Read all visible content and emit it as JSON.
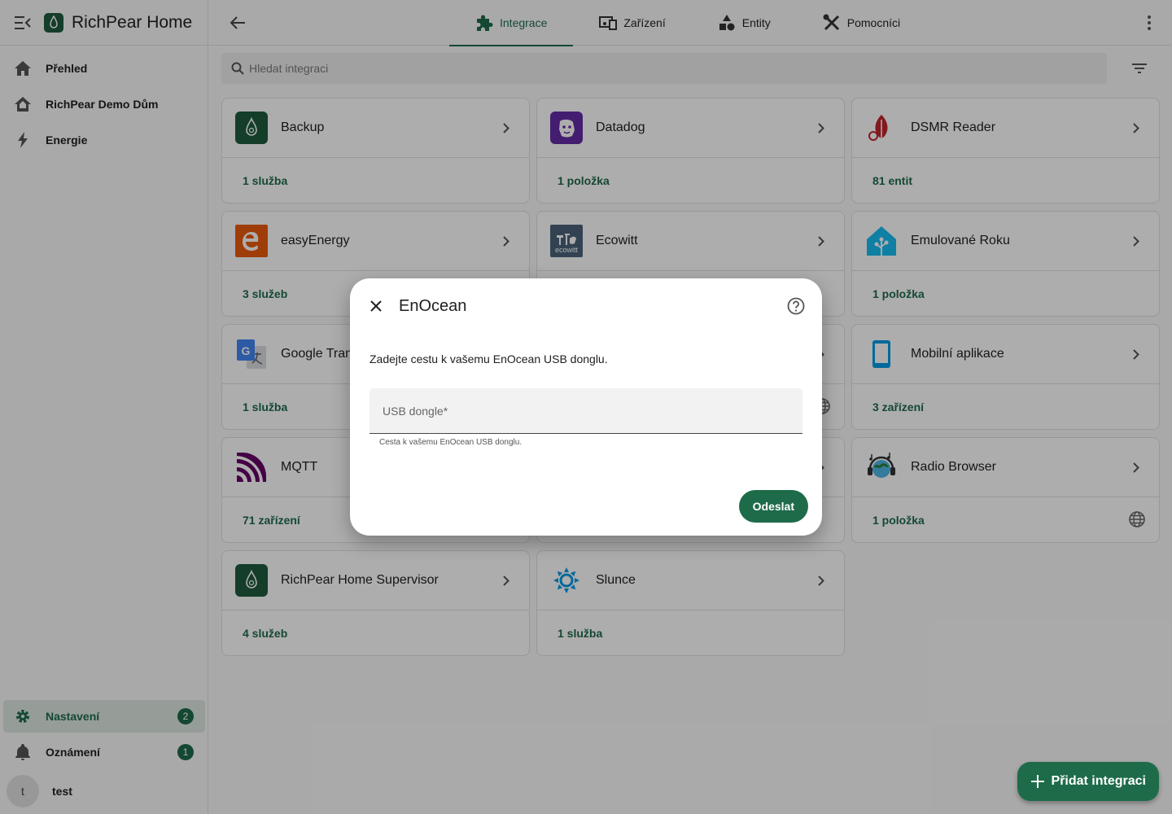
{
  "app": {
    "title": "RichPear Home"
  },
  "sidebar": {
    "items": [
      {
        "label": "Přehled",
        "icon": "home-icon"
      },
      {
        "label": "RichPear Demo Dům",
        "icon": "house-roof-icon"
      },
      {
        "label": "Energie",
        "icon": "lightning-icon"
      }
    ],
    "settings": {
      "label": "Nastavení",
      "badge": "2"
    },
    "notifications": {
      "label": "Oznámení",
      "badge": "1"
    },
    "user": {
      "initial": "t",
      "name": "test"
    }
  },
  "tabs": [
    {
      "label": "Integrace",
      "active": true
    },
    {
      "label": "Zařízení",
      "active": false
    },
    {
      "label": "Entity",
      "active": false
    },
    {
      "label": "Pomocníci",
      "active": false
    }
  ],
  "search": {
    "placeholder": "Hledat integraci"
  },
  "integrations": [
    {
      "name": "Backup",
      "link": "1 služba"
    },
    {
      "name": "Datadog",
      "link": "1 položka"
    },
    {
      "name": "DSMR Reader",
      "link": "81 entit"
    },
    {
      "name": "easyEnergy",
      "link": "3 služeb"
    },
    {
      "name": "Ecowitt",
      "link": ""
    },
    {
      "name": "Emulované Roku",
      "link": "1 položka"
    },
    {
      "name": "Google Translate",
      "link": "1 služba"
    },
    {
      "name": "",
      "link": ""
    },
    {
      "name": "Mobilní aplikace",
      "link": "3 zařízení"
    },
    {
      "name": "MQTT",
      "link": "71 zařízení"
    },
    {
      "name": "",
      "link": ""
    },
    {
      "name": "Radio Browser",
      "link": "1 položka"
    },
    {
      "name": "RichPear Home Supervisor",
      "link": "4 služeb"
    },
    {
      "name": "Slunce",
      "link": "1 služba"
    }
  ],
  "ecowitt_logo_text": "ecowitt",
  "dialog": {
    "title": "EnOcean",
    "description": "Zadejte cestu k vašemu EnOcean USB donglu.",
    "field_placeholder": "USB dongle*",
    "field_value": "",
    "helper": "Cesta k vašemu EnOcean USB donglu.",
    "submit": "Odeslat"
  },
  "fab": {
    "label": "Přidat integraci"
  },
  "colors": {
    "primary": "#1e6b4a",
    "scrim": "rgba(0,0,0,0.32)"
  }
}
